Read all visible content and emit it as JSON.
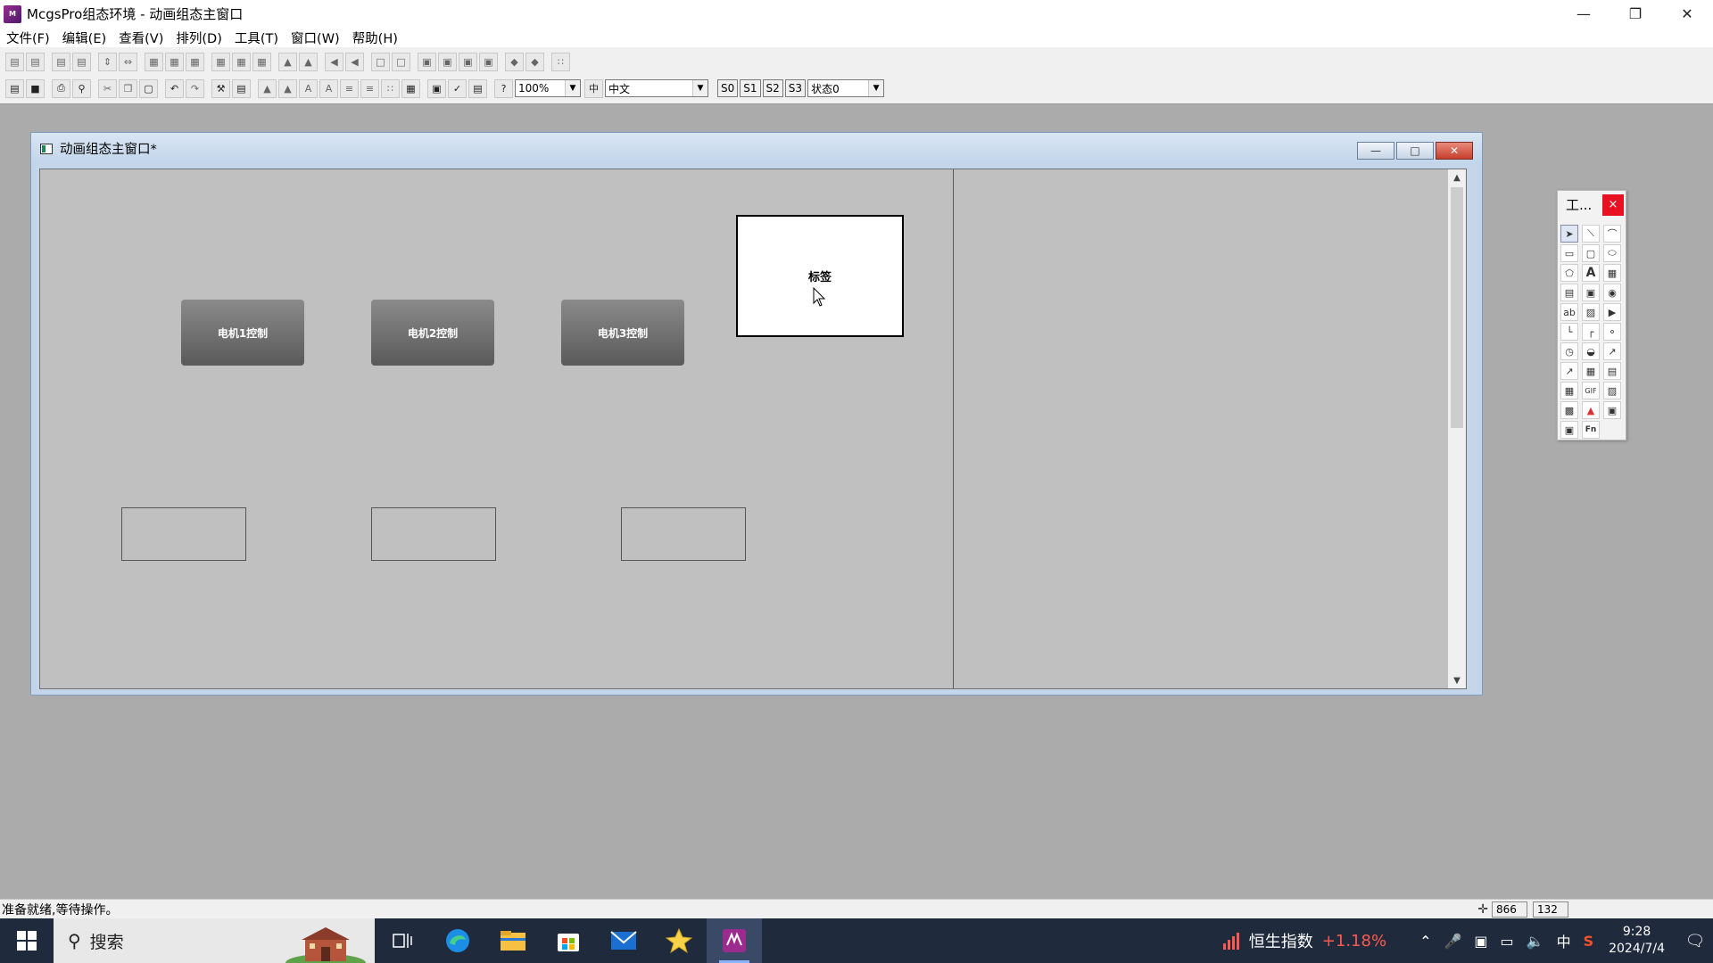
{
  "app": {
    "title": "McgsPro组态环境 - 动画组态主窗口"
  },
  "menu": [
    "文件(F)",
    "编辑(E)",
    "查看(V)",
    "排列(D)",
    "工具(T)",
    "窗口(W)",
    "帮助(H)"
  ],
  "toolbar": {
    "zoom_value": "100%",
    "language_value": "中文",
    "state_buttons": [
      "S0",
      "S1",
      "S2",
      "S3"
    ],
    "state_value": "状态0"
  },
  "child_window": {
    "title": "动画组态主窗口*",
    "canvas": {
      "motor_buttons": [
        "电机1控制",
        "电机2控制",
        "电机3控制"
      ],
      "label_text": "标签"
    }
  },
  "palette": {
    "title": "工...",
    "close": "×"
  },
  "status": {
    "text": "准备就绪,等待操作。",
    "coord_x": "866",
    "coord_y": "132"
  },
  "taskbar": {
    "search_placeholder": "搜索",
    "stock_name": "恒生指数",
    "stock_change": "+1.18%",
    "ime": "中",
    "time": "9:28",
    "date": "2024/7/4"
  }
}
